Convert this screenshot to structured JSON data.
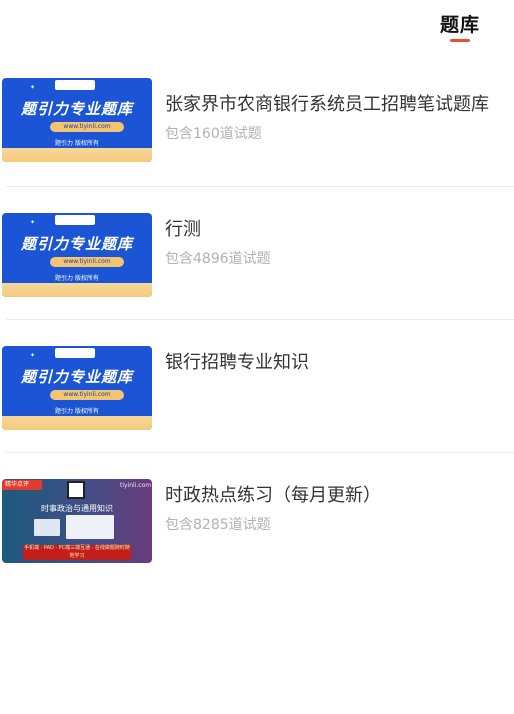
{
  "header": {
    "tab_label": "题库"
  },
  "items": [
    {
      "title": "张家界市农商银行系统员工招聘笔试题库",
      "subtitle": "包含160道试题",
      "thumb": {
        "variant": "blue",
        "banner_text": "题引力专业题库",
        "url": "www.tiyinli.com",
        "footer": "题引力 版权所有"
      }
    },
    {
      "title": "行测",
      "subtitle": "包含4896道试题",
      "thumb": {
        "variant": "blue",
        "banner_text": "题引力专业题库",
        "url": "www.tiyinli.com",
        "footer": "题引力 版权所有"
      }
    },
    {
      "title": "银行招聘专业知识",
      "subtitle": "",
      "thumb": {
        "variant": "blue",
        "banner_text": "题引力专业题库",
        "url": "www.tiyinli.com",
        "footer": "题引力 版权所有"
      }
    },
    {
      "title": "时政热点练习（每月更新）",
      "subtitle": "包含8285道试题",
      "thumb": {
        "variant": "dark",
        "tag": "精华点评",
        "site": "tiyinli.com",
        "headline": "时事政治与通用知识",
        "promo": "手机端 · PAD · PC端三端互通 · 在线做题随时随地学习"
      }
    }
  ],
  "colors": {
    "accent": "#e8532e",
    "subtitle": "#b2b2b2",
    "divider": "#ececec",
    "banner_blue": "#1b55d6"
  }
}
